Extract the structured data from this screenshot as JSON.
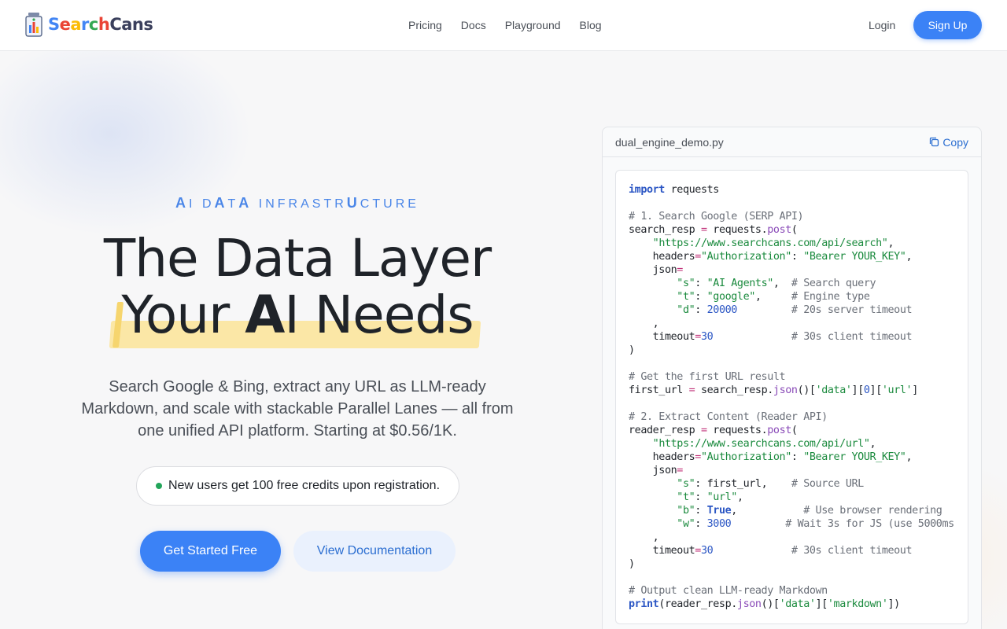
{
  "brand": {
    "name_parts": [
      {
        "text": "S",
        "color": "#4285f4"
      },
      {
        "text": "e",
        "color": "#ea4335"
      },
      {
        "text": "a",
        "color": "#fbbc05"
      },
      {
        "text": "r",
        "color": "#4285f4"
      },
      {
        "text": "c",
        "color": "#34a853"
      },
      {
        "text": "h",
        "color": "#ea4335"
      },
      {
        "text": "Cans",
        "color": "#3a3f5c"
      }
    ]
  },
  "nav": {
    "items": [
      "Pricing",
      "Docs",
      "Playground",
      "Blog"
    ],
    "login": "Login",
    "signup": "Sign Up"
  },
  "hero": {
    "eyebrow": "AI DATA INFRASTRUCTURE",
    "title_line1": "The Data Layer",
    "title_line2_pre": "Your ",
    "title_line2_bold": "A",
    "title_line2_post": "I Needs",
    "subtitle": "Search Google & Bing, extract any URL as LLM-ready Markdown, and scale with stackable Parallel Lanes — all from one unified API platform. Starting at $0.56/1K.",
    "notice": "New users get 100 free credits upon registration.",
    "cta_primary": "Get Started Free",
    "cta_secondary": "View Documentation"
  },
  "code_panel": {
    "filename": "dual_engine_demo.py",
    "copy_label": "Copy",
    "lines": [
      "import requests",
      "",
      "# 1. Search Google (SERP API)",
      "search_resp = requests.post(",
      "    \"https://www.searchcans.com/api/search\",",
      "    headers=\"Authorization\": \"Bearer YOUR_KEY\",",
      "    json=",
      "        \"s\": \"AI Agents\",  # Search query",
      "        \"t\": \"google\",     # Engine type",
      "        \"d\": 20000         # 20s server timeout",
      "    ,",
      "    timeout=30             # 30s client timeout",
      ")",
      "",
      "# Get the first URL result",
      "first_url = search_resp.json()['data'][0]['url']",
      "",
      "# 2. Extract Content (Reader API)",
      "reader_resp = requests.post(",
      "    \"https://www.searchcans.com/api/url\",",
      "    headers=\"Authorization\": \"Bearer YOUR_KEY\",",
      "    json=",
      "        \"s\": first_url,    # Source URL",
      "        \"t\": \"url\",",
      "        \"b\": True,           # Use browser rendering",
      "        \"w\": 3000         # Wait 3s for JS (use 5000ms",
      "    ,",
      "    timeout=30             # 30s client timeout",
      ")",
      "",
      "# Output clean LLM-ready Markdown",
      "print(reader_resp.json()['data']['markdown'])"
    ]
  },
  "colors": {
    "accent": "#3b82f6",
    "highlight": "#fbe7a6",
    "notice_dot": "#22a55a"
  }
}
